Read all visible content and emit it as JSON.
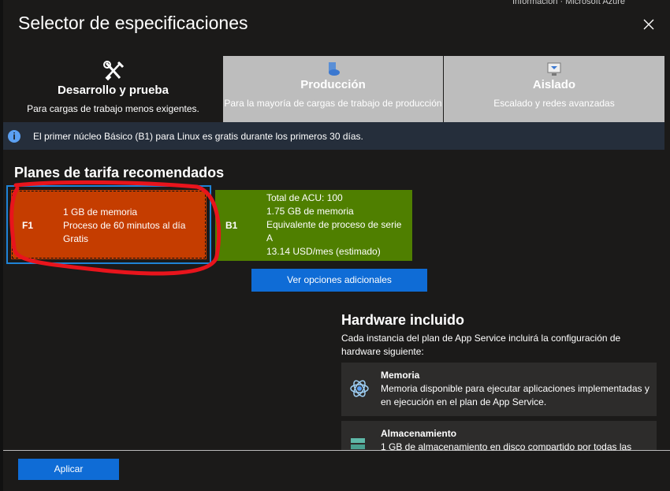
{
  "header": {
    "title": "Selector de especificaciones",
    "top_partial_text": "Información · Microsoft Azure"
  },
  "tabs": [
    {
      "name": "Desarrollo y prueba",
      "desc": "Para cargas de trabajo menos exigentes.",
      "icon": "tools-icon",
      "active": true
    },
    {
      "name": "Producción",
      "desc": "Para la mayoría de cargas de trabajo de producción",
      "icon": "server-cloud-icon",
      "active": false
    },
    {
      "name": "Aislado",
      "desc": "Escalado y redes avanzadas",
      "icon": "isolated-monitor-icon",
      "active": false
    }
  ],
  "banner": {
    "text": "El primer núcleo Básico (B1) para Linux es gratis durante los primeros 30 días.",
    "icon": "info-icon"
  },
  "plans": {
    "title": "Planes de tarifa recomendados",
    "f1": {
      "code": "F1",
      "lines": [
        "1 GB de memoria",
        "Proceso de 60 minutos al día",
        "Gratis"
      ],
      "color": "#c53d00",
      "selected": true
    },
    "b1": {
      "code": "B1",
      "lines": [
        "Total de ACU: 100",
        "1.75 GB de memoria",
        "Equivalente de proceso de serie",
        "A",
        "13.14 USD/mes (estimado)"
      ],
      "color": "#4f7f00"
    }
  },
  "more_options_label": "Ver opciones adicionales",
  "hardware": {
    "title": "Hardware incluido",
    "desc": "Cada instancia del plan de App Service incluirá la configuración de hardware siguiente:",
    "features": [
      {
        "name": "Memoria",
        "text": "Memoria disponible para ejecutar aplicaciones implementadas y en ejecución en el plan de App Service.",
        "icon": "memory-atom-icon"
      },
      {
        "name": "Almacenamiento",
        "text": "1 GB de almacenamiento en disco compartido por todas las",
        "icon": "storage-icon"
      }
    ]
  },
  "footer": {
    "apply_label": "Aplicar"
  },
  "colors": {
    "accent": "#0f6cd6",
    "background": "#1b1a19",
    "annotation": "#e8141c"
  }
}
